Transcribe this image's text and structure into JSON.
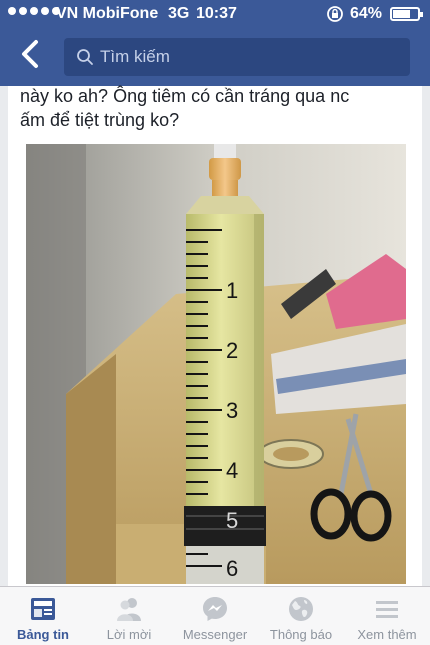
{
  "status_bar": {
    "carrier": "VN MobiFone",
    "network": "3G",
    "time": "10:37",
    "battery": "64%"
  },
  "nav": {
    "search_placeholder": "Tìm kiếm"
  },
  "post": {
    "text_line1": "này ko ah? Ông tiêm có cần tráng qua nc",
    "text_line2": "ấm để tiệt trùng ko?",
    "photo_scale_labels": [
      "1",
      "2",
      "3",
      "4",
      "5",
      "6"
    ]
  },
  "tabs": [
    {
      "label": "Bảng tin",
      "icon": "news-feed-icon",
      "active": true
    },
    {
      "label": "Lời mời",
      "icon": "friend-requests-icon",
      "active": false
    },
    {
      "label": "Messenger",
      "icon": "messenger-icon",
      "active": false
    },
    {
      "label": "Thông báo",
      "icon": "globe-icon",
      "active": false
    },
    {
      "label": "Xem thêm",
      "icon": "menu-icon",
      "active": false
    }
  ],
  "colors": {
    "brand": "#3b5998",
    "search_bg": "#2c4780",
    "tab_inactive": "#8d949e"
  }
}
